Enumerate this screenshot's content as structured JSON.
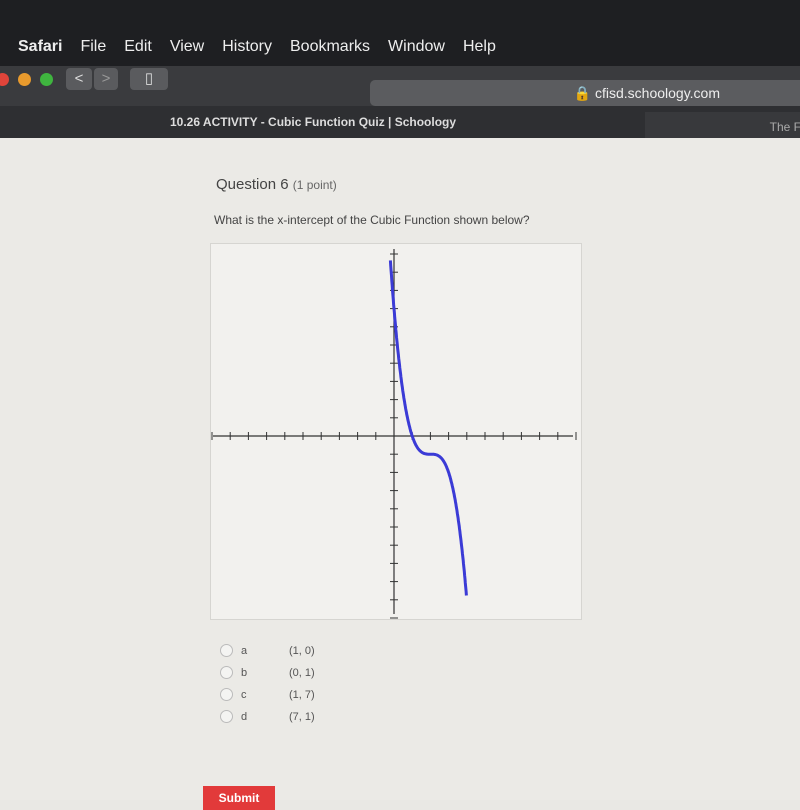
{
  "menu": [
    "Safari",
    "File",
    "Edit",
    "View",
    "History",
    "Bookmarks",
    "Window",
    "Help"
  ],
  "browser": {
    "back": "<",
    "forward": ">",
    "url": "cfisd.schoology.com",
    "tab_title": "10.26 ACTIVITY - Cubic Function Quiz | Schoology",
    "tab2_title": "The F"
  },
  "question": {
    "title": "Question 6",
    "points": "(1 point)",
    "text": "What is the x-intercept of the Cubic Function shown below?"
  },
  "chart_data": {
    "type": "line",
    "function": "cubic, decreasing, crosses x-axis at x=1",
    "xlim": [
      -10,
      10
    ],
    "ylim": [
      -10,
      10
    ],
    "curve_color": "#3b3bd6",
    "grid": false
  },
  "options": [
    {
      "letter": "a",
      "value": "(1, 0)"
    },
    {
      "letter": "b",
      "value": "(0, 1)"
    },
    {
      "letter": "c",
      "value": "(1, 7)"
    },
    {
      "letter": "d",
      "value": "(7, 1)"
    }
  ],
  "submit_label": "Submit"
}
